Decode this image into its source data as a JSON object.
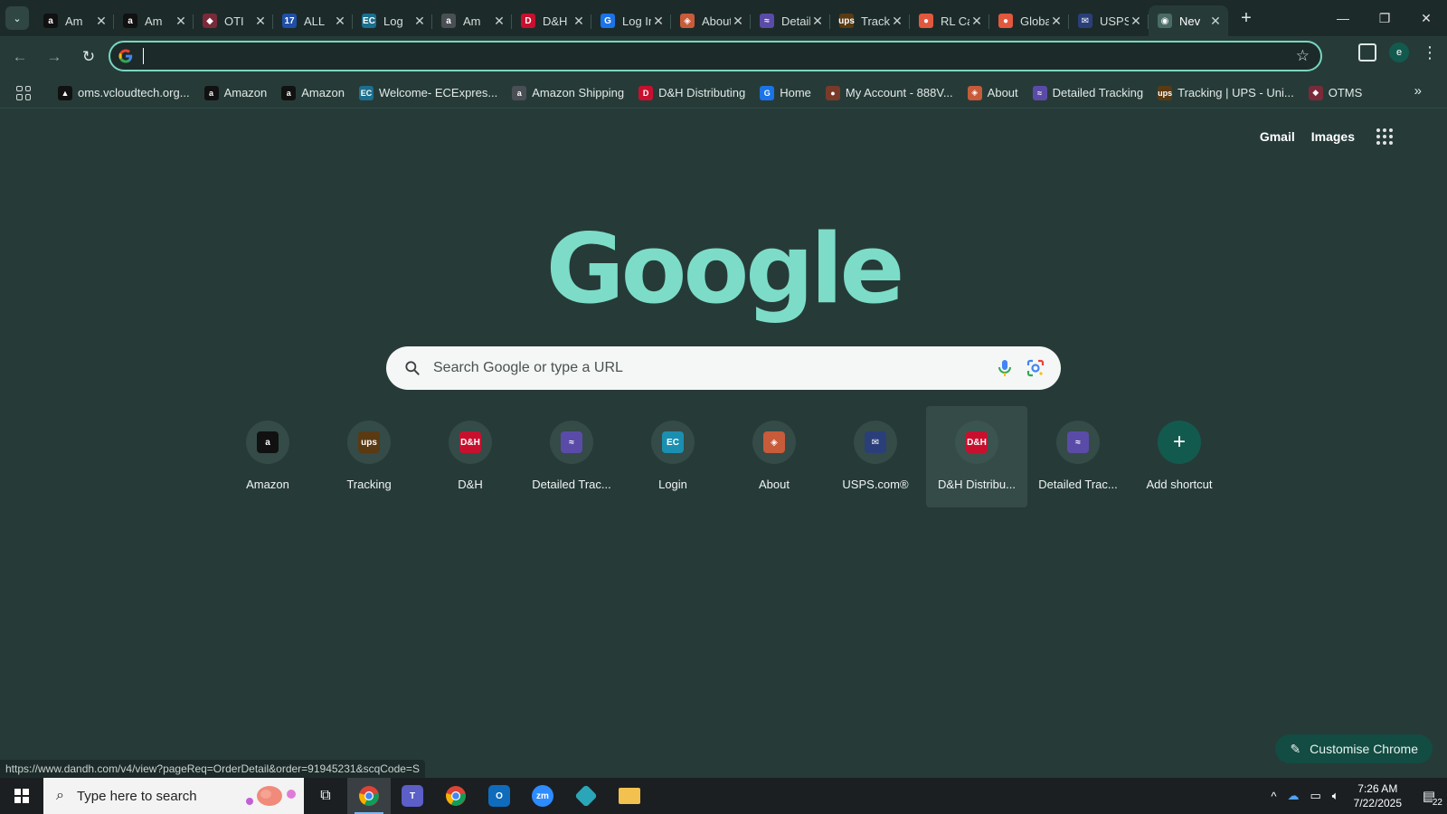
{
  "tabs": [
    {
      "label": "Am",
      "icon": "amazon-icon",
      "fav": "a",
      "color": "#111111"
    },
    {
      "label": "Am",
      "icon": "amazon-icon",
      "fav": "a",
      "color": "#111111"
    },
    {
      "label": "OTI",
      "icon": "otms-icon",
      "fav": "◆",
      "color": "#7a2a3a"
    },
    {
      "label": "ALL",
      "icon": "17track-icon",
      "fav": "17",
      "color": "#1f4fa8"
    },
    {
      "label": "Log",
      "icon": "ecexpress-icon",
      "fav": "EC",
      "color": "#1b6f8f"
    },
    {
      "label": "Am",
      "icon": "amazon-icon",
      "fav": "a",
      "color": "#4a4f55"
    },
    {
      "label": "D&H D",
      "icon": "dandh-icon",
      "fav": "D",
      "color": "#c8102e"
    },
    {
      "label": "Log In",
      "icon": "login-g-icon",
      "fav": "G",
      "color": "#1a73e8"
    },
    {
      "label": "About",
      "icon": "about-cube-icon",
      "fav": "◈",
      "color": "#c75b3a"
    },
    {
      "label": "Detailed",
      "icon": "detailed-tracking-icon",
      "fav": "≈",
      "color": "#5b4ba8"
    },
    {
      "label": "Tracking",
      "icon": "ups-icon",
      "fav": "ups",
      "color": "#5a3a12"
    },
    {
      "label": "RL Carri",
      "icon": "rl-carriers-icon",
      "fav": "●",
      "color": "#e2583e"
    },
    {
      "label": "Global F",
      "icon": "global-icon",
      "fav": "●",
      "color": "#e2583e"
    },
    {
      "label": "USPS.co",
      "icon": "usps-icon",
      "fav": "✉",
      "color": "#2a3f7a"
    },
    {
      "label": "Nev",
      "icon": "chrome-newtab-icon",
      "fav": "◉",
      "color": "#4b6b66",
      "active": true
    }
  ],
  "omnibox": {
    "value": ""
  },
  "bookmarks": [
    {
      "label": "oms.vcloudtech.org...",
      "icon": "vcloud-icon",
      "fav": "▲",
      "color": "#111111"
    },
    {
      "label": "Amazon",
      "icon": "amazon-icon",
      "fav": "a",
      "color": "#111111"
    },
    {
      "label": "Amazon",
      "icon": "amazon-icon",
      "fav": "a",
      "color": "#111111"
    },
    {
      "label": "Welcome- ECExpres...",
      "icon": "ecexpress-icon",
      "fav": "EC",
      "color": "#1b6f8f"
    },
    {
      "label": "Amazon Shipping",
      "icon": "amazon-icon",
      "fav": "a",
      "color": "#4a4f55"
    },
    {
      "label": "D&H Distributing",
      "icon": "dandh-icon",
      "fav": "D",
      "color": "#c8102e"
    },
    {
      "label": "Home",
      "icon": "home-g-icon",
      "fav": "G",
      "color": "#1a73e8"
    },
    {
      "label": "My Account - 888V...",
      "icon": "account-icon",
      "fav": "●",
      "color": "#7a3a2a"
    },
    {
      "label": "About",
      "icon": "about-cube-icon",
      "fav": "◈",
      "color": "#c75b3a"
    },
    {
      "label": "Detailed Tracking",
      "icon": "detailed-tracking-icon",
      "fav": "≈",
      "color": "#5b4ba8"
    },
    {
      "label": "Tracking | UPS - Uni...",
      "icon": "ups-icon",
      "fav": "ups",
      "color": "#5a3a12"
    },
    {
      "label": "OTMS",
      "icon": "otms-icon",
      "fav": "◆",
      "color": "#7a2a3a"
    }
  ],
  "toplinks": {
    "gmail": "Gmail",
    "images": "Images"
  },
  "logo": "Google",
  "search": {
    "placeholder": "Search Google or type a URL"
  },
  "shortcuts": [
    {
      "label": "Amazon",
      "icon": "amazon-icon",
      "fav": "a",
      "color": "#111111"
    },
    {
      "label": "Tracking",
      "icon": "ups-icon",
      "fav": "ups",
      "color": "#5a3a12"
    },
    {
      "label": "D&H",
      "icon": "dandh-icon",
      "fav": "D&H",
      "color": "#c8102e"
    },
    {
      "label": "Detailed Trac...",
      "icon": "detailed-tracking-icon",
      "fav": "≈",
      "color": "#5b4ba8"
    },
    {
      "label": "Login",
      "icon": "ecexpress-icon",
      "fav": "EC",
      "color": "#1b8fb0"
    },
    {
      "label": "About",
      "icon": "about-cube-icon",
      "fav": "◈",
      "color": "#c75b3a"
    },
    {
      "label": "USPS.com®",
      "icon": "usps-icon",
      "fav": "✉",
      "color": "#2a3f7a"
    },
    {
      "label": "D&H Distribu...",
      "icon": "dandh-icon",
      "fav": "D&H",
      "color": "#c8102e",
      "hover": true
    },
    {
      "label": "Detailed Trac...",
      "icon": "detailed-tracking-icon",
      "fav": "≈",
      "color": "#5b4ba8"
    }
  ],
  "add_shortcut": "Add shortcut",
  "customise": "Customise Chrome",
  "status_url": "https://www.dandh.com/v4/view?pageReq=OrderDetail&order=91945231&scqCode=S",
  "taskbar": {
    "search_placeholder": "Type here to search",
    "time": "7:26 AM",
    "date": "7/22/2025",
    "notifications": "22",
    "profile_initial": "e"
  }
}
